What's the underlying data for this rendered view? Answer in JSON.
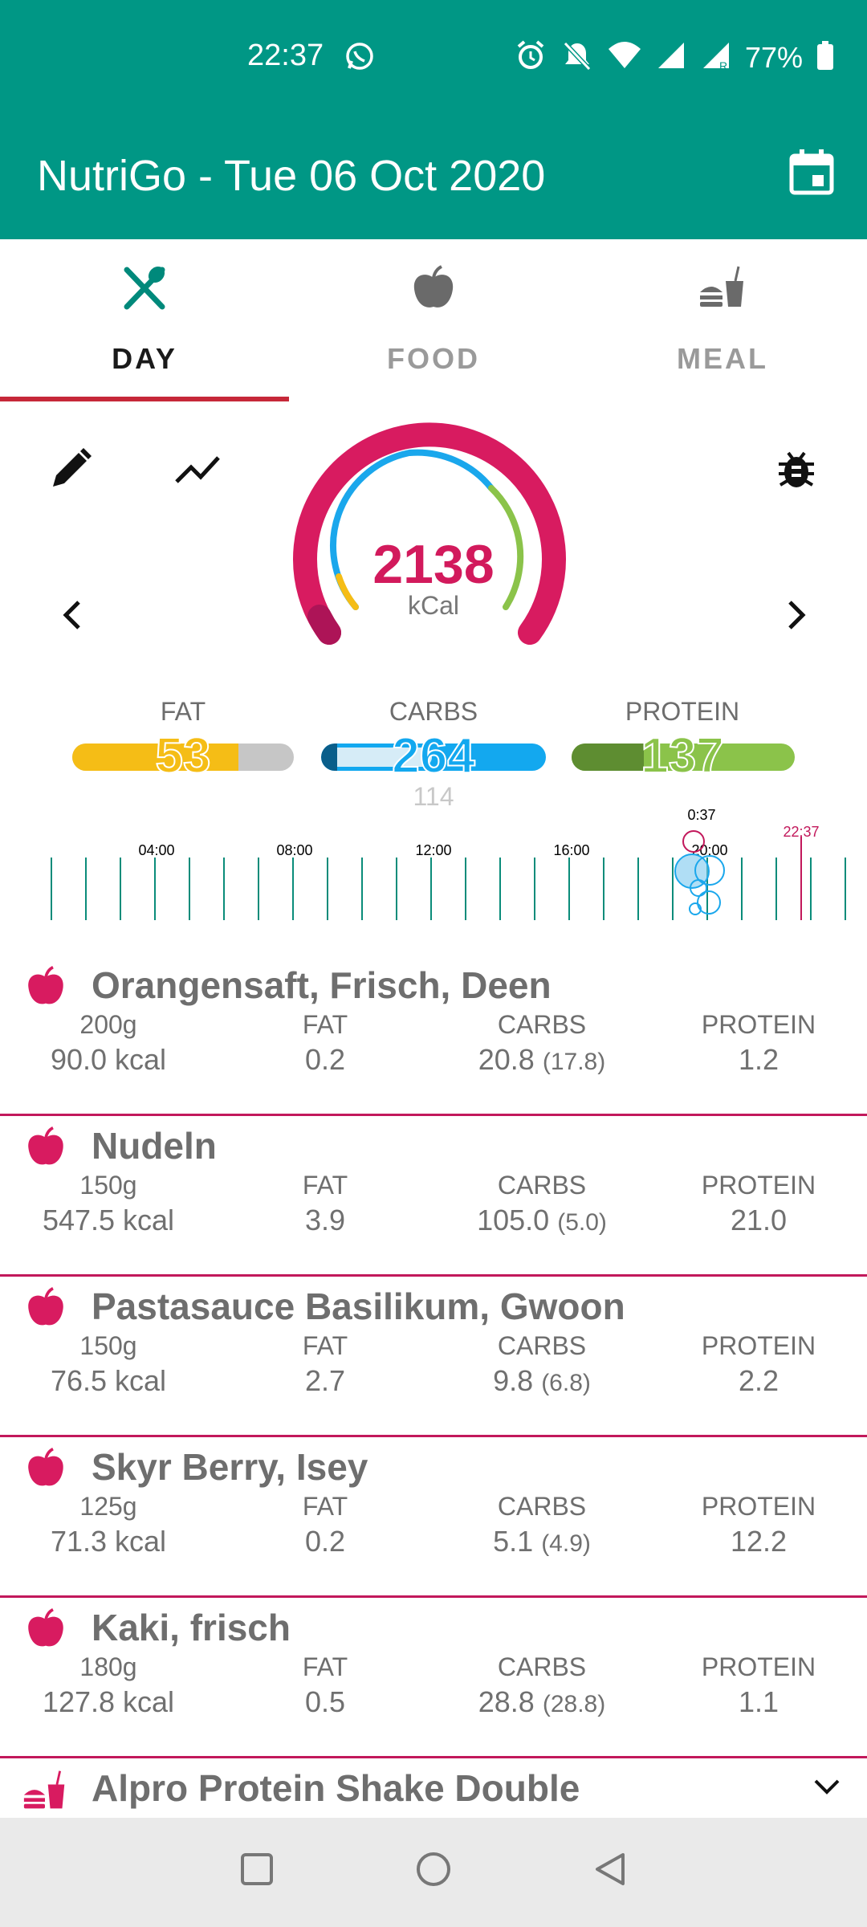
{
  "status_bar": {
    "time": "22:37",
    "battery": "77%"
  },
  "app_bar": {
    "title": "NutriGo -  Tue 06 Oct 2020"
  },
  "tabs": [
    {
      "label": "DAY",
      "icon": "fork-knife-icon",
      "active": true
    },
    {
      "label": "FOOD",
      "icon": "apple-icon",
      "active": false
    },
    {
      "label": "MEAL",
      "icon": "burger-drink-icon",
      "active": false
    }
  ],
  "gauge": {
    "kcal": "2138",
    "unit": "kCal"
  },
  "macros": {
    "fat": {
      "label": "FAT",
      "value": "53",
      "color": "#f5bd16",
      "fill": 0.75
    },
    "carbs": {
      "label": "CARBS",
      "value": "264",
      "sub": "114",
      "color": "#13a8ef",
      "fill": 1.0
    },
    "protein": {
      "label": "PROTEIN",
      "value": "137",
      "color": "#8bc34a",
      "fill": 1.0
    }
  },
  "timeline": {
    "ticks": [
      "04:00",
      "08:00",
      "12:00",
      "16:00",
      "20:00"
    ],
    "marker_label": "0:37",
    "now_label": "22:37"
  },
  "items": [
    {
      "name": "Orangensaft, Frisch, Deen",
      "amount": "200g",
      "kcal": "90.0 kcal",
      "fat_h": "FAT",
      "fat": "0.2",
      "carbs_h": "CARBS",
      "carbs": "20.8",
      "carbs_sub": "(17.8)",
      "protein_h": "PROTEIN",
      "protein": "1.2"
    },
    {
      "name": "Nudeln",
      "amount": "150g",
      "kcal": "547.5 kcal",
      "fat_h": "FAT",
      "fat": "3.9",
      "carbs_h": "CARBS",
      "carbs": "105.0",
      "carbs_sub": "(5.0)",
      "protein_h": "PROTEIN",
      "protein": "21.0"
    },
    {
      "name": "Pastasauce Basilikum, Gwoon",
      "amount": "150g",
      "kcal": "76.5 kcal",
      "fat_h": "FAT",
      "fat": "2.7",
      "carbs_h": "CARBS",
      "carbs": "9.8",
      "carbs_sub": "(6.8)",
      "protein_h": "PROTEIN",
      "protein": "2.2"
    },
    {
      "name": "Skyr Berry, Isey",
      "amount": "125g",
      "kcal": "71.3 kcal",
      "fat_h": "FAT",
      "fat": "0.2",
      "carbs_h": "CARBS",
      "carbs": "5.1",
      "carbs_sub": "(4.9)",
      "protein_h": "PROTEIN",
      "protein": "12.2"
    },
    {
      "name": "Kaki, frisch",
      "amount": "180g",
      "kcal": "127.8 kcal",
      "fat_h": "FAT",
      "fat": "0.5",
      "carbs_h": "CARBS",
      "carbs": "28.8",
      "carbs_sub": "(28.8)",
      "protein_h": "PROTEIN",
      "protein": "1.1"
    }
  ],
  "partial_item": {
    "name": "Alpro Protein Shake Double"
  },
  "colors": {
    "primary": "#009785",
    "accent": "#d21a5c",
    "tab_indicator": "#c62839"
  }
}
